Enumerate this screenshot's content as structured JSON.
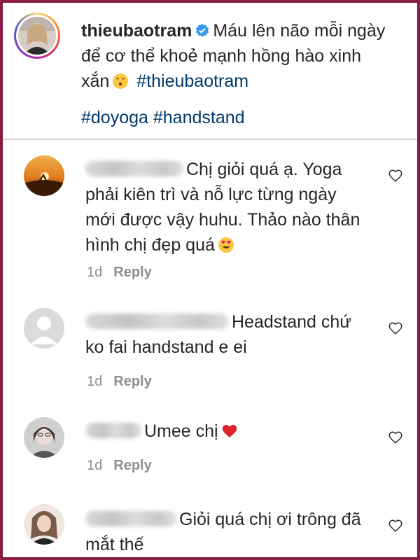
{
  "post": {
    "username": "thieubaotram",
    "caption_line1": "Máu lên não mỗi ngày",
    "caption_line2": "để cơ thể khoẻ mạnh hồng hào xinh",
    "caption_line3_prefix": "xắn",
    "caption_hashtag1": "#thieubaotram",
    "hashtags_line": "#doyoga #handstand"
  },
  "comments": [
    {
      "text_line1": "Chị giỏi quá ạ. Yoga",
      "text_line2": "phải kiên trì và nỗ lực từng ngày",
      "text_line3": "mới được vậy huhu. Thảo nào thân",
      "text_line4": "hình chị đẹp quá",
      "time": "1d",
      "reply": "Reply"
    },
    {
      "text_line1": "Headstand chứ",
      "text_line2": "ko fai handstand e ei",
      "time": "1d",
      "reply": "Reply"
    },
    {
      "text_line1": "Umee chị",
      "time": "1d",
      "reply": "Reply"
    },
    {
      "text_line1": "Giỏi quá chị ơi trông đã",
      "text_line2": "mắt thế"
    }
  ],
  "colors": {
    "frame": "#8a1d46",
    "hashtag": "#00376b",
    "meta": "#8e8e8e",
    "verified": "#3897f0"
  },
  "icons": {
    "verified": "verified-badge-icon",
    "like": "heart-outline-icon",
    "kiss_emoji": "kissing-face-emoji",
    "heart_eyes_emoji": "heart-eyes-emoji",
    "red_heart_emoji": "red-heart-emoji"
  }
}
